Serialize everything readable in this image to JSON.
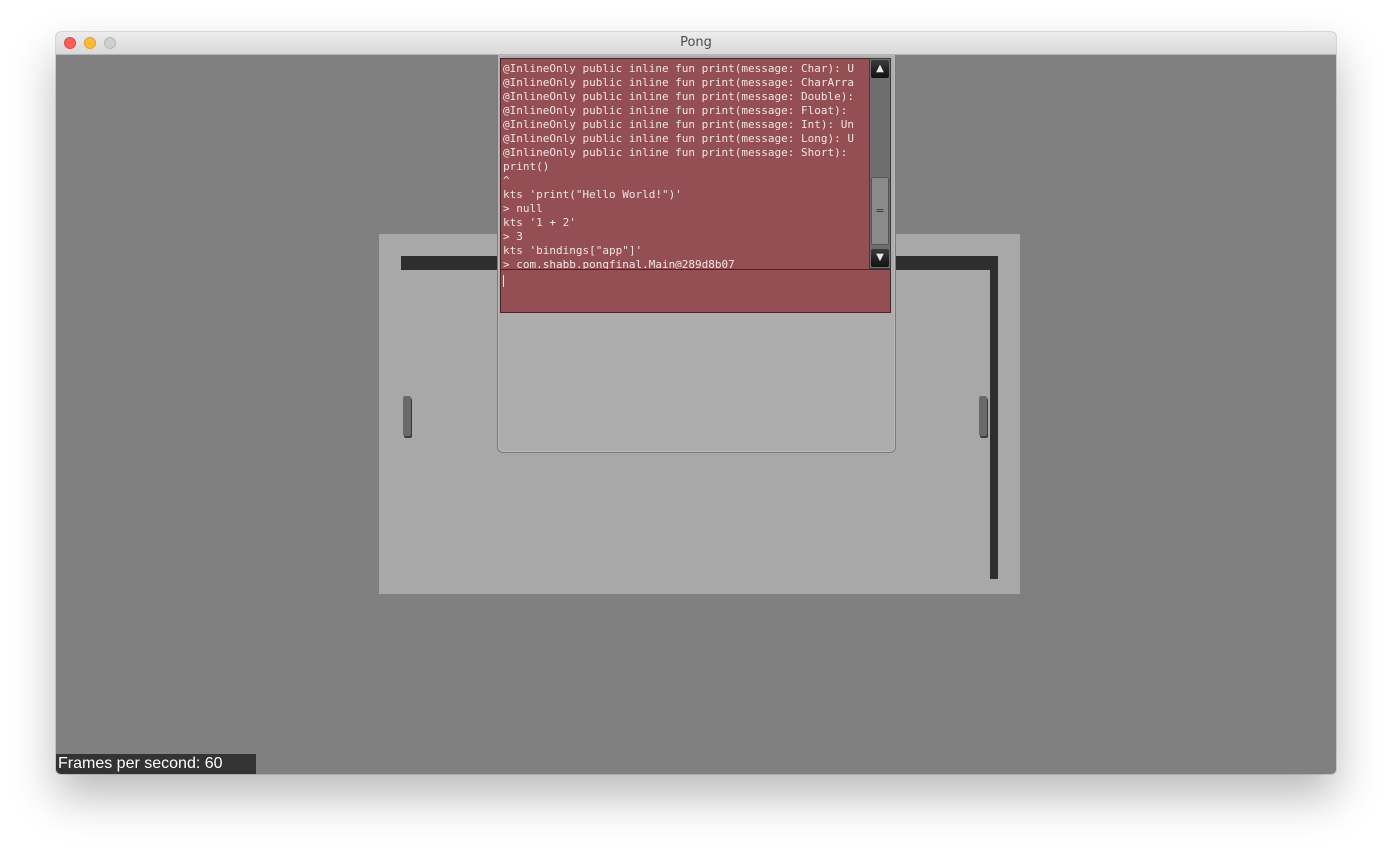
{
  "window": {
    "title": "Pong"
  },
  "console": {
    "lines": [
      "@InlineOnly public inline fun print(message: Char): U",
      "@InlineOnly public inline fun print(message: CharArra",
      "@InlineOnly public inline fun print(message: Double):",
      "@InlineOnly public inline fun print(message: Float):",
      "@InlineOnly public inline fun print(message: Int): Un",
      "@InlineOnly public inline fun print(message: Long): U",
      "@InlineOnly public inline fun print(message: Short):",
      "print()",
      "^",
      "kts 'print(\"Hello World!\")'",
      "> null",
      "kts '1 + 2'",
      "> 3",
      "kts 'bindings[\"app\"]'",
      "> com.shabb.pongfinal.Main@289d8b07"
    ],
    "input_value": "",
    "scroll_up_glyph": "▲",
    "scroll_down_glyph": "▼",
    "thumb_grip_glyph": "="
  },
  "status": {
    "fps_text": "Frames per second: 60"
  },
  "colors": {
    "console_bg": "#934f53",
    "game_bg": "#808080",
    "field_bg": "#a8a8a8",
    "wall": "#2e2e2e"
  }
}
